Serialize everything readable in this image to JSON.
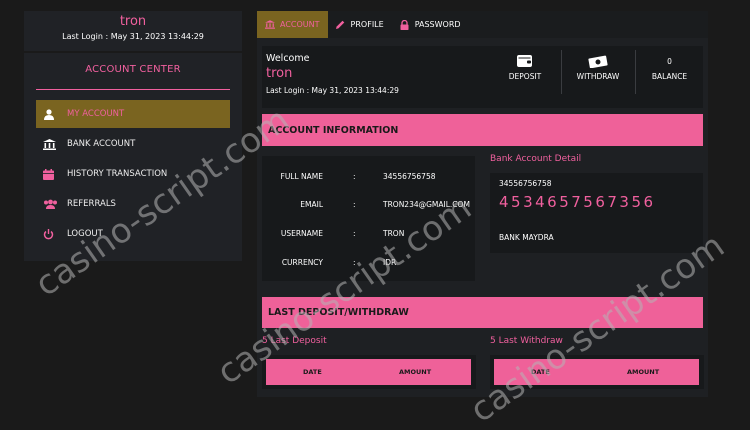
{
  "sidebar": {
    "username": "tron",
    "last_login": "Last Login : May 31, 2023 13:44:29",
    "title": "ACCOUNT CENTER",
    "items": [
      {
        "label": "MY ACCOUNT",
        "icon": "user-icon"
      },
      {
        "label": "BANK ACCOUNT",
        "icon": "bank-icon"
      },
      {
        "label": "HISTORY TRANSACTION",
        "icon": "calendar-icon"
      },
      {
        "label": "REFERRALS",
        "icon": "users-icon"
      },
      {
        "label": "LOGOUT",
        "icon": "power-icon"
      }
    ]
  },
  "tabs": [
    {
      "label": "ACCOUNT",
      "icon": "bank-icon"
    },
    {
      "label": "PROFILE",
      "icon": "pencil-icon"
    },
    {
      "label": "PASSWORD",
      "icon": "lock-icon"
    }
  ],
  "welcome": {
    "greeting": "Welcome",
    "username": "tron",
    "last_login": "Last Login : May 31, 2023 13:44:29",
    "deposit_label": "DEPOSIT",
    "withdraw_label": "WITHDRAW",
    "balance_value": "0",
    "balance_label": "BALANCE"
  },
  "account_info": {
    "title": "ACCOUNT INFORMATION",
    "rows": [
      {
        "key": "FULL NAME",
        "sep": ":",
        "value": "34556756758"
      },
      {
        "key": "EMAIL",
        "sep": ":",
        "value": "TRON234@GMAIL.COM"
      },
      {
        "key": "USERNAME",
        "sep": ":",
        "value": "TRON"
      },
      {
        "key": "CURRENCY",
        "sep": ":",
        "value": "IDR"
      }
    ]
  },
  "bank_detail": {
    "title": "Bank Account Detail",
    "account_name": "34556756758",
    "account_number": "4534657567356",
    "bank_name": "BANK MAYDRA"
  },
  "last_dw": {
    "title": "LAST DEPOSIT/WITHDRAW",
    "deposit_title": "5 Last Deposit",
    "withdraw_title": "5 Last Withdraw",
    "col_date": "DATE",
    "col_amount": "AMOUNT"
  },
  "watermark": "casino-script.com",
  "colors": {
    "accent": "#ef6199",
    "active": "#7a6420",
    "panel": "#202226"
  }
}
